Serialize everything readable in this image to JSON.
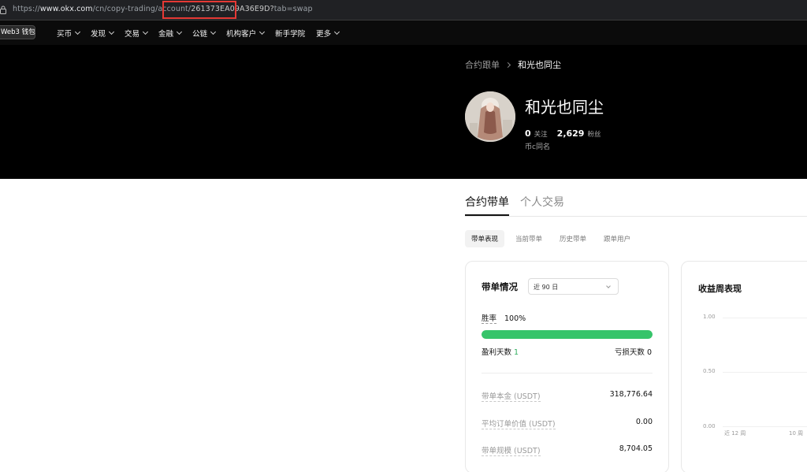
{
  "browser": {
    "url_prefix": "https://",
    "url_host": "www.okx.com",
    "url_path": "/cn/copy-trading/account/",
    "url_highlight": "261373EA09A36E9D?",
    "url_suffix": "tab=swap"
  },
  "nav": {
    "wallet_label": "Web3 钱包",
    "items": [
      {
        "label": "买币",
        "dropdown": true
      },
      {
        "label": "发现",
        "dropdown": true
      },
      {
        "label": "交易",
        "dropdown": true
      },
      {
        "label": "金融",
        "dropdown": true
      },
      {
        "label": "公链",
        "dropdown": true
      },
      {
        "label": "机构客户",
        "dropdown": true
      },
      {
        "label": "新手学院",
        "dropdown": false
      },
      {
        "label": "更多",
        "dropdown": true
      }
    ]
  },
  "profile": {
    "breadcrumb_root": "合约跟单",
    "breadcrumb_current": "和光也同尘",
    "name": "和光也同尘",
    "following_count": "0",
    "following_label": "关注",
    "followers_count": "2,629",
    "followers_label": "粉丝",
    "bio": "币c同名"
  },
  "tabs": {
    "main": [
      "合约带单",
      "个人交易"
    ],
    "sub": [
      "带单表现",
      "当前带单",
      "历史带单",
      "跟单用户"
    ]
  },
  "summary": {
    "title": "带单情况",
    "range": "近 90 日",
    "win_rate_label": "胜率",
    "win_rate": "100%",
    "win_rate_fraction": 1.0,
    "profit_days_label": "盈利天数",
    "profit_days": "1",
    "loss_days_label": "亏损天数",
    "loss_days": "0",
    "rows": [
      {
        "label": "带单本金 (USDT)",
        "value": "318,776.64"
      },
      {
        "label": "平均订单价值 (USDT)",
        "value": "0.00"
      },
      {
        "label": "带单规模 (USDT)",
        "value": "8,704.05"
      }
    ]
  },
  "weekly": {
    "title": "收益周表现",
    "y_ticks": [
      "1.00",
      "0.50",
      "0.00"
    ],
    "x_ticks": [
      "近 12 周",
      "10 周"
    ]
  },
  "colors": {
    "accent_green": "#36c46a",
    "highlight_box": "#e53935"
  }
}
